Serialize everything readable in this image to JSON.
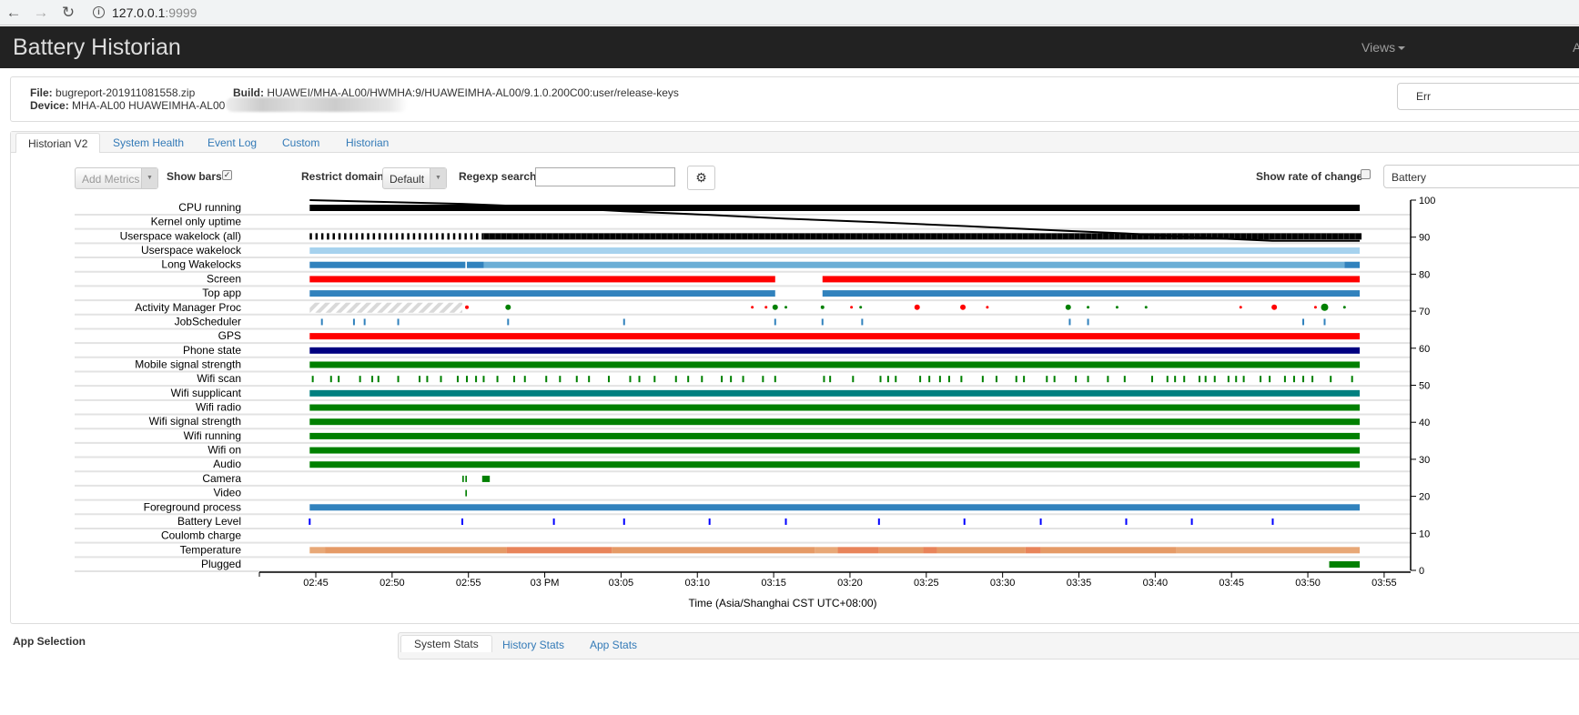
{
  "browser": {
    "url_host": "127.0.0.1",
    "url_port": ":9999",
    "back_icon": "arrow-left-icon",
    "forward_icon": "arrow-right-icon",
    "reload_icon": "reload-icon",
    "info_icon": "info-icon"
  },
  "navbar": {
    "title": "Battery Historian",
    "views_label": "Views",
    "extra_label": "A"
  },
  "info": {
    "file_label": "File:",
    "file_value": "bugreport-201911081558.zip",
    "device_label": "Device:",
    "device_value": "MHA-AL00 HUAWEIMHA-AL00",
    "build_label": "Build:",
    "build_value": "HUAWEI/MHA-AL00/HWMHA:9/HUAWEIMHA-AL00/9.1.0.200C00:user/release-keys",
    "errors_button": "Err"
  },
  "tabs": [
    {
      "label": "Historian V2",
      "active": true
    },
    {
      "label": "System Health"
    },
    {
      "label": "Event Log"
    },
    {
      "label": "Custom"
    },
    {
      "label": "Historian"
    }
  ],
  "controls": {
    "add_metrics": "Add Metrics",
    "show_bars": "Show bars",
    "show_bars_checked": true,
    "restrict_domain": "Restrict domain",
    "domain_value": "Default",
    "regexp_search": "Regexp search",
    "regexp_value": "",
    "show_rate": "Show rate of change",
    "show_rate_checked": false,
    "right_select": "Battery",
    "settings_icon": "gear-icon"
  },
  "chart_data": {
    "type": "timeline",
    "x_axis": {
      "label": "Time (Asia/Shanghai CST UTC+08:00)",
      "range": [
        "02:41.3",
        "03:56.7"
      ],
      "ticks": [
        "02:45",
        "02:50",
        "02:55",
        "03 PM",
        "03:05",
        "03:10",
        "03:15",
        "03:20",
        "03:25",
        "03:30",
        "03:35",
        "03:40",
        "03:45",
        "03:50",
        "03:55"
      ]
    },
    "y2_axis": {
      "range": [
        0,
        100
      ],
      "ticks": [
        0,
        10,
        20,
        30,
        40,
        50,
        60,
        70,
        80,
        90,
        100
      ]
    },
    "battery_line": [
      [
        "02:44.6",
        100
      ],
      [
        "02:54.6",
        99
      ],
      [
        "03:00.6",
        98
      ],
      [
        "03:05.2",
        97
      ],
      [
        "03:10.8",
        96
      ],
      [
        "03:15.8",
        95
      ],
      [
        "03:21.9",
        94
      ],
      [
        "03:27.5",
        93
      ],
      [
        "03:32.5",
        92
      ],
      [
        "03:38.1",
        91
      ],
      [
        "03:42.4",
        90
      ],
      [
        "03:47.7",
        89
      ],
      [
        "03:53.4",
        89
      ]
    ],
    "rows": [
      {
        "label": "CPU running",
        "color": "#000000",
        "segments": [
          [
            "02:44.6",
            "03:53.4"
          ]
        ]
      },
      {
        "label": "Kernel only uptime",
        "segments": []
      },
      {
        "label": "Userspace wakelock (all)",
        "color": "#000000",
        "style": "ticks",
        "segments": [
          [
            "02:44.6",
            "02:56.0"
          ]
        ],
        "solid": [
          [
            "02:56.0",
            "03:53.4"
          ]
        ]
      },
      {
        "label": "Userspace wakelock",
        "color": "#a6d2ee",
        "segments": [
          [
            "02:44.6",
            "03:53.4"
          ]
        ]
      },
      {
        "label": "Long Wakelocks",
        "color": "#3182bd",
        "segments": [
          [
            "02:44.6",
            "02:54.8"
          ],
          [
            "02:54.9",
            "02:56.0",
            "#3182bd"
          ],
          [
            "02:56.0",
            "03:52.4",
            "#6baed6"
          ],
          [
            "03:52.4",
            "03:53.4"
          ]
        ]
      },
      {
        "label": "Screen",
        "color": "#ff0000",
        "segments": [
          [
            "02:44.6",
            "03:15.1"
          ],
          [
            "03:18.2",
            "03:53.4"
          ]
        ]
      },
      {
        "label": "Top app",
        "color": "#3182bd",
        "segments": [
          [
            "02:44.6",
            "02:54.6"
          ],
          [
            "02:54.6",
            "03:15.1"
          ],
          [
            "03:18.2",
            "03:53.4"
          ]
        ]
      },
      {
        "label": "Activity Manager Proc",
        "hatched": [
          [
            "02:44.6",
            "02:54.6"
          ]
        ],
        "dots": [
          [
            "02:54.9",
            "#ff0000",
            2
          ],
          [
            "02:57.6",
            "#008000",
            3
          ],
          [
            "03:13.6",
            "#ff0000",
            1.5
          ],
          [
            "03:14.5",
            "#ff0000",
            1.5
          ],
          [
            "03:15.1",
            "#008000",
            3
          ],
          [
            "03:15.8",
            "#008000",
            1.5
          ],
          [
            "03:18.2",
            "#008000",
            2
          ],
          [
            "03:20.1",
            "#ff0000",
            1.5
          ],
          [
            "03:20.7",
            "#008000",
            1.5
          ],
          [
            "03:24.4",
            "#ff0000",
            3
          ],
          [
            "03:27.4",
            "#ff0000",
            3
          ],
          [
            "03:29.0",
            "#ff0000",
            1.5
          ],
          [
            "03:34.3",
            "#008000",
            3
          ],
          [
            "03:35.6",
            "#008000",
            1.5
          ],
          [
            "03:37.5",
            "#008000",
            1.5
          ],
          [
            "03:39.4",
            "#008000",
            1.5
          ],
          [
            "03:45.6",
            "#ff0000",
            1.5
          ],
          [
            "03:47.8",
            "#ff0000",
            3
          ],
          [
            "03:50.5",
            "#ff0000",
            1.5
          ],
          [
            "03:51.1",
            "#008000",
            4
          ],
          [
            "03:52.4",
            "#008000",
            1.5
          ]
        ]
      },
      {
        "label": "JobScheduler",
        "color": "#3182bd",
        "marks": [
          "02:45.4",
          "02:47.5",
          "02:48.2",
          "02:50.4",
          "02:57.6",
          "03:05.2",
          "03:15.1",
          "03:18.2",
          "03:20.8",
          "03:34.4",
          "03:35.6",
          "03:49.7",
          "03:51.1"
        ]
      },
      {
        "label": "GPS",
        "color": "#ff0000",
        "segments": [
          [
            "02:44.6",
            "03:53.4"
          ]
        ]
      },
      {
        "label": "Phone state",
        "color": "#000080",
        "segments": [
          [
            "02:44.6",
            "03:53.4"
          ]
        ]
      },
      {
        "label": "Mobile signal strength",
        "color": "#008000",
        "segments": [
          [
            "02:44.6",
            "03:53.4"
          ]
        ]
      },
      {
        "label": "Wifi scan",
        "color": "#008000",
        "marks": [
          "02:44.8",
          "02:46.0",
          "02:46.5",
          "02:47.9",
          "02:48.7",
          "02:49.1",
          "02:50.4",
          "02:51.8",
          "02:52.3",
          "02:53.2",
          "02:54.3",
          "02:54.9",
          "02:55.5",
          "02:56.0",
          "02:56.9",
          "02:58.0",
          "02:58.7",
          "03:00.1",
          "03:01.0",
          "03:02.1",
          "03:02.9",
          "03:04.2",
          "03:05.6",
          "03:06.2",
          "03:07.2",
          "03:08.6",
          "03:09.4",
          "03:10.3",
          "03:11.6",
          "03:12.2",
          "03:13.0",
          "03:14.3",
          "03:15.1",
          "03:18.3",
          "03:18.7",
          "03:20.2",
          "03:22.0",
          "03:22.5",
          "03:23.0",
          "03:24.6",
          "03:25.2",
          "03:25.9",
          "03:26.5",
          "03:27.3",
          "03:28.7",
          "03:29.6",
          "03:30.9",
          "03:31.4",
          "03:32.9",
          "03:33.4",
          "03:34.8",
          "03:35.6",
          "03:36.9",
          "03:38.0",
          "03:39.8",
          "03:40.8",
          "03:41.3",
          "03:41.9",
          "03:42.9",
          "03:43.3",
          "03:43.9",
          "03:44.8",
          "03:45.3",
          "03:45.8",
          "03:46.9",
          "03:47.5",
          "03:48.5",
          "03:49.1",
          "03:49.7",
          "03:50.3",
          "03:51.5",
          "03:52.9"
        ]
      },
      {
        "label": "Wifi supplicant",
        "color": "#008080",
        "segments": [
          [
            "02:44.6",
            "03:53.4"
          ]
        ]
      },
      {
        "label": "Wifi radio",
        "color": "#008000",
        "segments": [
          [
            "02:44.6",
            "03:53.4"
          ]
        ]
      },
      {
        "label": "Wifi signal strength",
        "color": "#008000",
        "segments": [
          [
            "02:44.6",
            "03:53.4"
          ]
        ]
      },
      {
        "label": "Wifi running",
        "color": "#008000",
        "segments": [
          [
            "02:44.6",
            "03:53.4"
          ]
        ]
      },
      {
        "label": "Wifi on",
        "color": "#008000",
        "segments": [
          [
            "02:44.6",
            "03:53.4"
          ]
        ]
      },
      {
        "label": "Audio",
        "color": "#008000",
        "segments": [
          [
            "02:44.6",
            "03:53.4"
          ]
        ]
      },
      {
        "label": "Camera",
        "color": "#008000",
        "segments": [
          [
            "02:54.6",
            "02:54.7"
          ],
          [
            "02:54.8",
            "02:54.9"
          ],
          [
            "02:55.9",
            "02:56.4"
          ]
        ]
      },
      {
        "label": "Video",
        "color": "#008000",
        "segments": [
          [
            "02:54.8",
            "02:54.9"
          ]
        ]
      },
      {
        "label": "Foreground process",
        "color": "#3182bd",
        "segments": [
          [
            "02:44.6",
            "03:53.4"
          ]
        ]
      },
      {
        "label": "Battery Level",
        "color": "#0000ff",
        "marks": [
          "02:44.6",
          "02:54.6",
          "03:00.6",
          "03:05.2",
          "03:10.8",
          "03:15.8",
          "03:21.9",
          "03:27.5",
          "03:32.5",
          "03:38.1",
          "03:42.4",
          "03:47.7"
        ]
      },
      {
        "label": "Coulomb charge",
        "segments": []
      },
      {
        "label": "Temperature",
        "color": "#e59a66",
        "segments": [
          [
            "02:44.6",
            "02:45.6",
            "#e8a877"
          ],
          [
            "02:45.6",
            "02:57.5"
          ],
          [
            "02:57.5",
            "03:04.4",
            "#e8845a"
          ],
          [
            "03:04.4",
            "03:17.7"
          ],
          [
            "03:17.7",
            "03:19.2",
            "#e8a877"
          ],
          [
            "03:19.2",
            "03:21.9",
            "#e8845a"
          ],
          [
            "03:21.9",
            "03:24.8"
          ],
          [
            "03:24.8",
            "03:25.7",
            "#e8845a"
          ],
          [
            "03:25.7",
            "03:31.5"
          ],
          [
            "03:31.5",
            "03:32.5",
            "#e8845a"
          ],
          [
            "03:32.5",
            "03:41.4"
          ],
          [
            "03:41.4",
            "03:53.4",
            "#e8a877"
          ]
        ]
      },
      {
        "label": "Plugged",
        "color": "#008000",
        "segments": [
          [
            "03:51.4",
            "03:53.4"
          ]
        ]
      }
    ]
  },
  "bottom": {
    "app_selection": "App Selection",
    "tabs": [
      {
        "label": "System Stats",
        "active": true
      },
      {
        "label": "History Stats"
      },
      {
        "label": "App Stats"
      }
    ]
  }
}
